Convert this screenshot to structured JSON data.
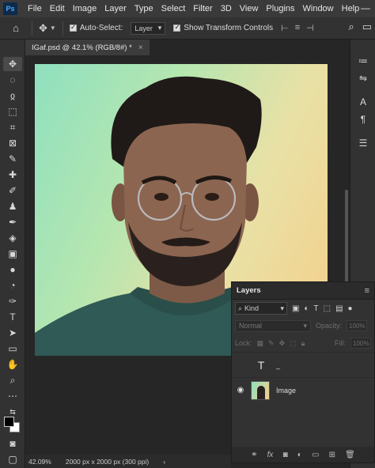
{
  "app": {
    "logo": "Ps"
  },
  "menu": [
    "File",
    "Edit",
    "Image",
    "Layer",
    "Type",
    "Select",
    "Filter",
    "3D",
    "View",
    "Plugins",
    "Window",
    "Help"
  ],
  "window_controls": {
    "minimize": "—"
  },
  "options": {
    "auto_select_label": "Auto-Select:",
    "auto_select_value": "Layer",
    "show_transform_label": "Show Transform Controls"
  },
  "document_tab": {
    "title": "IGaf.psd @ 42.1% (RGB/8#) *",
    "close": "×"
  },
  "tools": [
    "move-tool",
    "marquee-tool",
    "lasso-tool",
    "object-select-tool",
    "crop-tool",
    "frame-tool",
    "eyedropper-tool",
    "healing-brush-tool",
    "brush-tool",
    "clone-stamp-tool",
    "history-brush-tool",
    "eraser-tool",
    "gradient-tool",
    "blur-tool",
    "dodge-tool",
    "pen-tool",
    "type-tool",
    "path-select-tool",
    "shape-tool",
    "hand-tool",
    "zoom-tool",
    "more-tools"
  ],
  "layers_panel": {
    "tab_label": "Layers",
    "kind_label": "Kind",
    "blend_mode": "Normal",
    "opacity_label": "Opacity:",
    "opacity_value": "100%",
    "lock_label": "Lock:",
    "fill_label": "Fill:",
    "fill_value": "100%",
    "layers": [
      {
        "name": "_",
        "type": "text",
        "type_glyph": "T"
      },
      {
        "name": "Image",
        "type": "image"
      }
    ]
  },
  "status": {
    "zoom": "42.09%",
    "dimensions": "2000 px x 2000 px (300 ppi)",
    "arrow": "›"
  }
}
